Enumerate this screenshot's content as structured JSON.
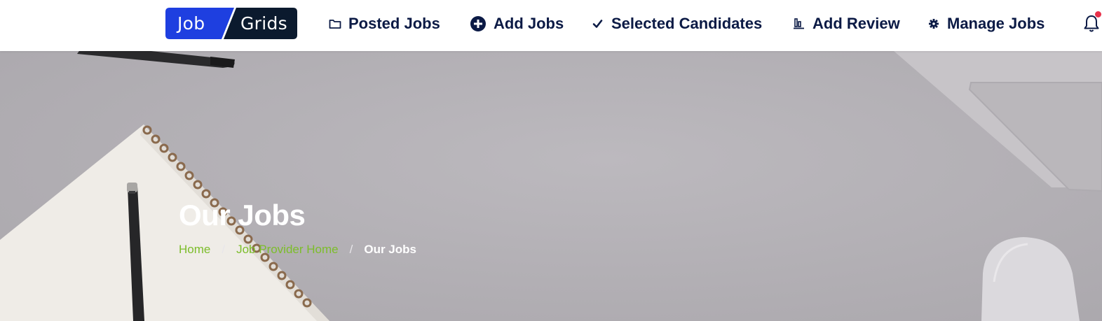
{
  "brand": {
    "logo_left": "Job",
    "logo_right": "Grids",
    "primary_color": "#1e3fe0",
    "dark_color": "#0b1a2e",
    "accent_green": "#7cbd2a"
  },
  "nav": {
    "items": [
      {
        "label": "Posted Jobs",
        "icon": "folder-icon"
      },
      {
        "label": "Add Jobs",
        "icon": "plus-circle-icon"
      },
      {
        "label": "Selected Candidates",
        "icon": "check-icon"
      },
      {
        "label": "Add Review",
        "icon": "bar-chart-icon"
      },
      {
        "label": "Manage Jobs",
        "icon": "gear-icon"
      }
    ],
    "notification_icon": "bell-icon"
  },
  "hero": {
    "title": "Our Jobs",
    "breadcrumb": [
      {
        "label": "Home",
        "link": true
      },
      {
        "label": "Job Provider Home",
        "link": true
      },
      {
        "label": "Our Jobs",
        "link": false
      }
    ],
    "separator": "/"
  }
}
